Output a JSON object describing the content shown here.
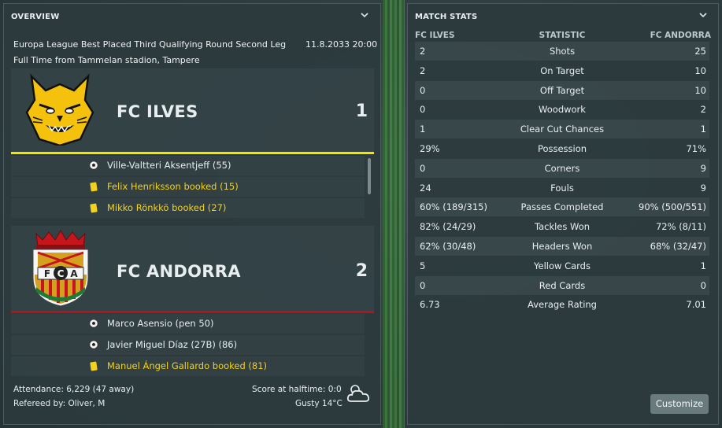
{
  "overview": {
    "title": "OVERVIEW",
    "competition": "Europa League Best Placed Third Qualifying Round Second Leg",
    "datetime": "11.8.2033 20:00",
    "venue_line": "Full Time from Tammelan stadion, Tampere",
    "home": {
      "name": "FC ILVES",
      "score": "1",
      "color": "#f2e600",
      "events": [
        {
          "type": "goal-icon",
          "text": "Ville-Valtteri Aksentjeff (55)",
          "highlight": false
        },
        {
          "type": "yellow-card-icon",
          "text": "Felix Henriksson booked (15)",
          "highlight": true
        },
        {
          "type": "yellow-card-icon",
          "text": "Mikko Rönkkö booked (27)",
          "highlight": true
        }
      ]
    },
    "away": {
      "name": "FC ANDORRA",
      "score": "2",
      "color": "#b0161c",
      "events": [
        {
          "type": "goal-icon",
          "text": "Marco Asensio (pen 50)",
          "highlight": false
        },
        {
          "type": "goal-icon",
          "text": "Javier Miguel Díaz (27B) (86)",
          "highlight": false
        },
        {
          "type": "yellow-card-icon",
          "text": "Manuel Ángel Gallardo booked (81)",
          "highlight": true
        }
      ]
    },
    "attendance": "Attendance: 6,229 (47 away)",
    "referee": "Refereed by: Oliver, M",
    "halftime": "Score at halftime: 0:0",
    "weather": "Gusty 14°C",
    "weather_icon": "cloud-icon"
  },
  "match_stats": {
    "title": "MATCH STATS",
    "col_home": "FC ILVES",
    "col_stat": "STATISTIC",
    "col_away": "FC ANDORRA",
    "rows": [
      {
        "home": "2",
        "stat": "Shots",
        "away": "25"
      },
      {
        "home": "2",
        "stat": "On Target",
        "away": "10"
      },
      {
        "home": "0",
        "stat": "Off Target",
        "away": "10"
      },
      {
        "home": "0",
        "stat": "Woodwork",
        "away": "2"
      },
      {
        "home": "1",
        "stat": "Clear Cut Chances",
        "away": "1"
      },
      {
        "home": "29%",
        "stat": "Possession",
        "away": "71%"
      },
      {
        "home": "0",
        "stat": "Corners",
        "away": "9"
      },
      {
        "home": "24",
        "stat": "Fouls",
        "away": "9"
      },
      {
        "home": "60% (189/315)",
        "stat": "Passes Completed",
        "away": "90% (500/551)"
      },
      {
        "home": "82% (24/29)",
        "stat": "Tackles Won",
        "away": "72% (8/11)"
      },
      {
        "home": "62% (30/48)",
        "stat": "Headers Won",
        "away": "68% (32/47)"
      },
      {
        "home": "5",
        "stat": "Yellow Cards",
        "away": "1"
      },
      {
        "home": "0",
        "stat": "Red Cards",
        "away": "0"
      },
      {
        "home": "6.73",
        "stat": "Average Rating",
        "away": "7.01"
      }
    ],
    "customize_label": "Customize"
  }
}
